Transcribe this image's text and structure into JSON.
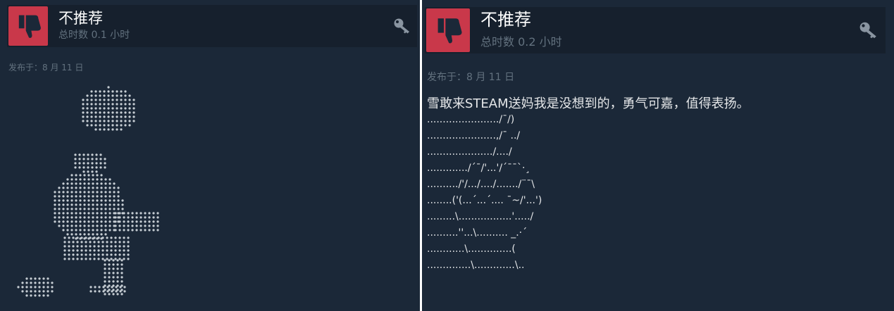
{
  "left_review": {
    "verdict": "不推荐",
    "hours": "总时数 0.1 小时",
    "posted": "发布于：8 月 11 日",
    "icons": {
      "thumb": "thumbs-down-icon",
      "award": "key-icon"
    },
    "art": "braille dot-art figure"
  },
  "right_review": {
    "verdict": "不推荐",
    "hours": "总时数 0.2 小时",
    "posted": "发布于：8 月 11 日",
    "text": "雪敢来STEAM送妈我是没想到的，勇气可嘉，值得表扬。",
    "ascii_lines": [
      "......................./¯/)",
      "......................,/¯ ../",
      "...................../..../",
      "............./´¯/'...'/´¯¯`·¸",
      "........../'/.../..../......./¨¯\\",
      "........('(...´...´.... ¯~/'...')",
      ".........\\.................'...../",
      "..........''...\\.......... _.·´",
      "............\\..............(",
      "..............\\.............\\.."
    ],
    "icons": {
      "thumb": "thumbs-down-icon",
      "award": "key-icon"
    }
  },
  "colors": {
    "background": "#1b2838",
    "header_background": "#16202d",
    "thumb_background": "#c9384a",
    "muted_text": "#63727f",
    "text": "#e5e7e9"
  }
}
